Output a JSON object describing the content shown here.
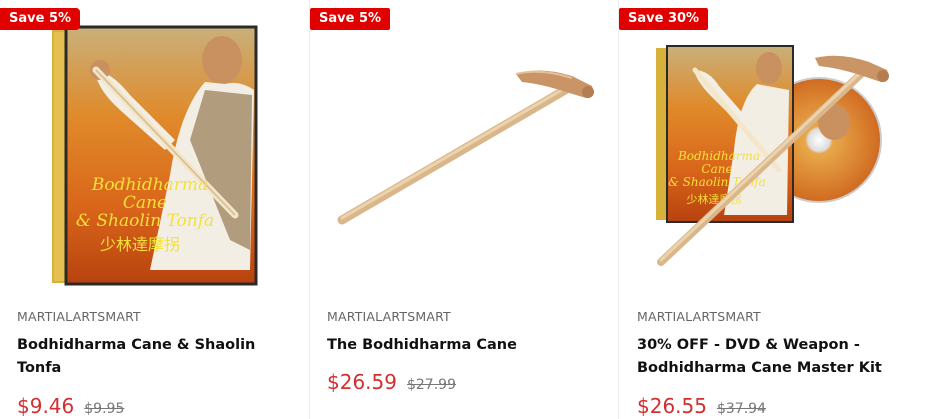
{
  "products": [
    {
      "badge": "Save 5%",
      "vendor": "MARTIALARTSMART",
      "title": "Bodhidharma Cane & Shaolin Tonfa",
      "price": "$9.46",
      "compare_price": "$9.95",
      "image": {
        "icon": "dvd-case-image",
        "cover_title_line1": "Bodhidharma",
        "cover_title_line2": "Cane",
        "cover_title_line3": "& Shaolin Tonfa",
        "cover_chinese": "少林達摩拐"
      }
    },
    {
      "badge": "Save 5%",
      "vendor": "MARTIALARTSMART",
      "title": "The Bodhidharma Cane",
      "price": "$26.59",
      "compare_price": "$27.99",
      "image": {
        "icon": "wooden-cane-image"
      }
    },
    {
      "badge": "Save 30%",
      "vendor": "MARTIALARTSMART",
      "title": "30% OFF - DVD & Weapon - Bodhidharma Cane Master Kit",
      "price": "$26.55",
      "compare_price": "$37.94",
      "image": {
        "icon": "dvd-and-cane-image",
        "cover_title_line1": "Bodhidharma",
        "cover_title_line2": "Cane",
        "cover_title_line3": "& Shaolin Tonfa",
        "cover_chinese": "少林達摩拐"
      }
    }
  ],
  "colors": {
    "badge": "#e00000",
    "price": "#d32f2f",
    "compare": "#777777",
    "title": "#111111"
  }
}
